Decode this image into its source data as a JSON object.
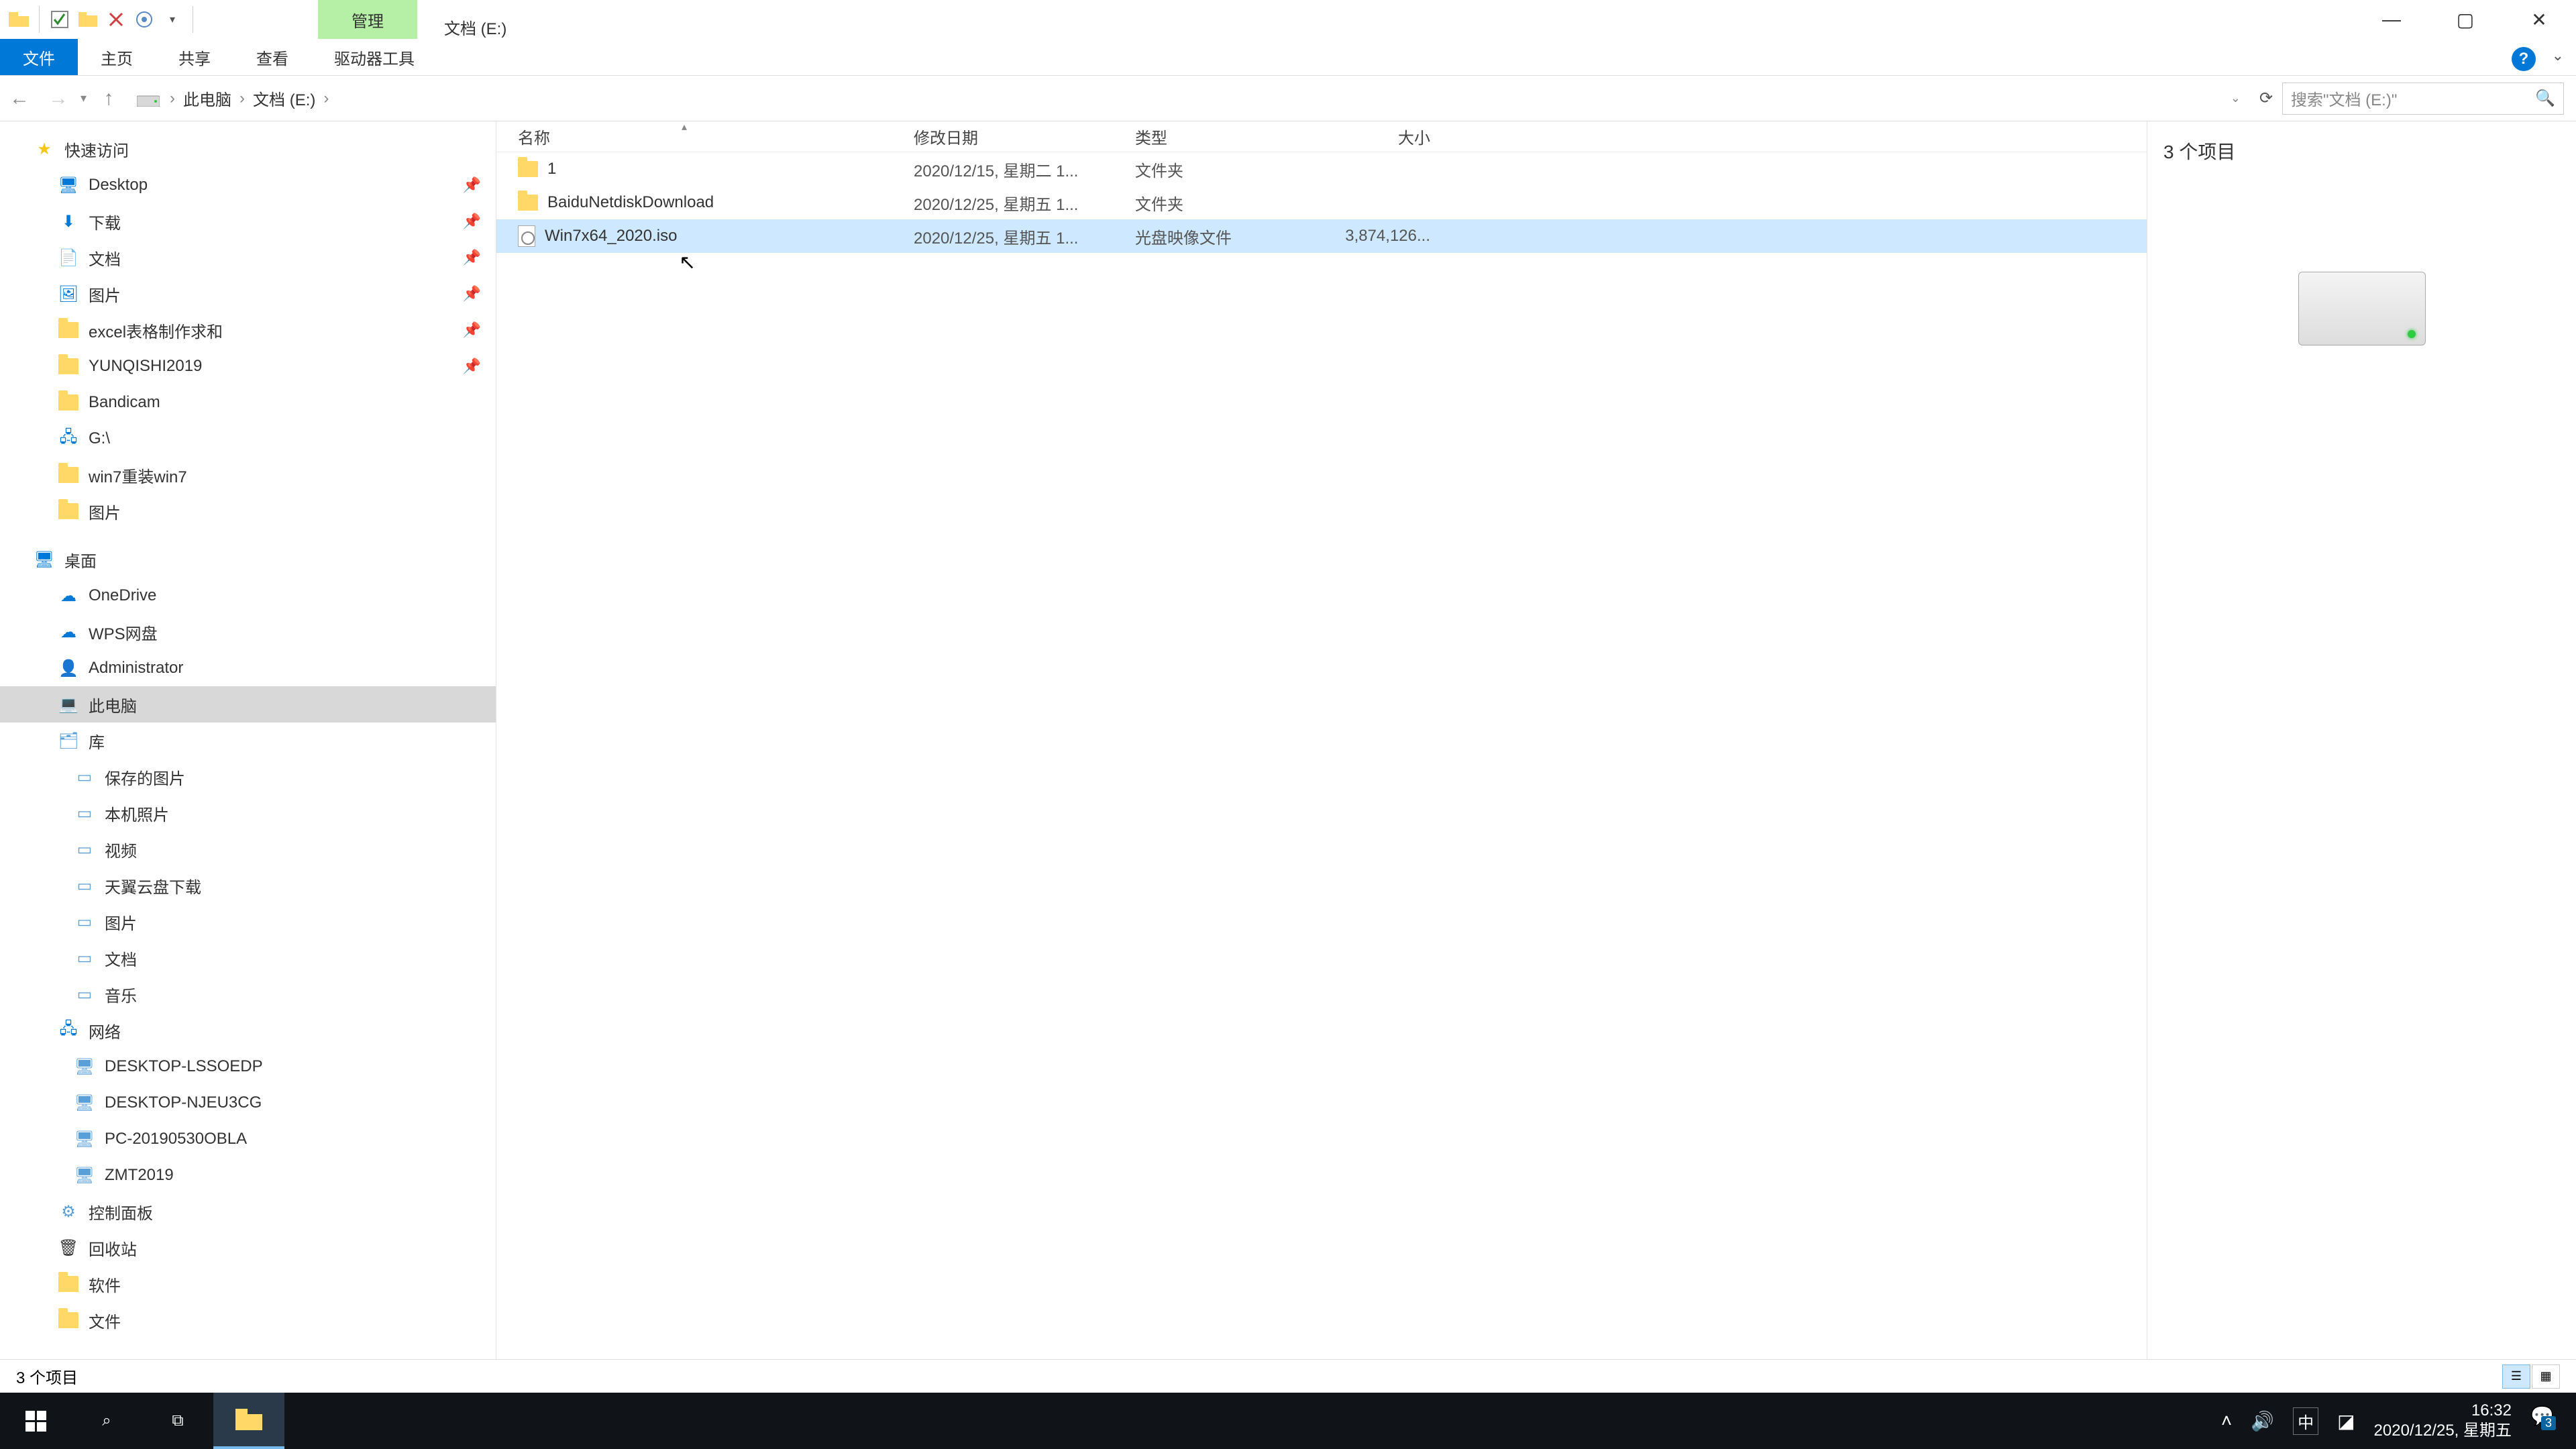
{
  "title": "文档 (E:)",
  "ribbon_context": "管理",
  "tabs": {
    "file": "文件",
    "home": "主页",
    "share": "共享",
    "view": "查看",
    "drive": "驱动器工具"
  },
  "breadcrumb": [
    "此电脑",
    "文档 (E:)"
  ],
  "search": {
    "placeholder": "搜索\"文档 (E:)\""
  },
  "columns": {
    "name": "名称",
    "date": "修改日期",
    "type": "类型",
    "size": "大小"
  },
  "rows": [
    {
      "name": "1",
      "date": "2020/12/15, 星期二 1...",
      "type": "文件夹",
      "size": "",
      "kind": "folder",
      "selected": false
    },
    {
      "name": "BaiduNetdiskDownload",
      "date": "2020/12/25, 星期五 1...",
      "type": "文件夹",
      "size": "",
      "kind": "folder",
      "selected": false
    },
    {
      "name": "Win7x64_2020.iso",
      "date": "2020/12/25, 星期五 1...",
      "type": "光盘映像文件",
      "size": "3,874,126...",
      "kind": "iso",
      "selected": true
    }
  ],
  "tree": {
    "quick": "快速访问",
    "quick_items": [
      {
        "l": "Desktop",
        "p": true,
        "ic": "desktop"
      },
      {
        "l": "下载",
        "p": true,
        "ic": "dl"
      },
      {
        "l": "文档",
        "p": true,
        "ic": "doc"
      },
      {
        "l": "图片",
        "p": true,
        "ic": "pic"
      },
      {
        "l": "excel表格制作求和",
        "p": true,
        "ic": "folder"
      },
      {
        "l": "YUNQISHI2019",
        "p": true,
        "ic": "folder"
      },
      {
        "l": "Bandicam",
        "p": false,
        "ic": "folder"
      },
      {
        "l": "G:\\",
        "p": false,
        "ic": "net"
      },
      {
        "l": "win7重装win7",
        "p": false,
        "ic": "folder"
      },
      {
        "l": "图片",
        "p": false,
        "ic": "folder"
      }
    ],
    "desktop": "桌面",
    "onedrive": "OneDrive",
    "wps": "WPS网盘",
    "admin": "Administrator",
    "thispc": "此电脑",
    "libs": "库",
    "lib_items": [
      "保存的图片",
      "本机照片",
      "视频",
      "天翼云盘下载",
      "图片",
      "文档",
      "音乐"
    ],
    "network": "网络",
    "net_items": [
      "DESKTOP-LSSOEDP",
      "DESKTOP-NJEU3CG",
      "PC-20190530OBLA",
      "ZMT2019"
    ],
    "cpanel": "控制面板",
    "recycle": "回收站",
    "soft": "软件",
    "wenjian": "文件"
  },
  "preview": {
    "count": "3 个项目"
  },
  "status": {
    "items": "3 个项目"
  },
  "taskbar": {
    "time": "16:32",
    "date": "2020/12/25, 星期五",
    "ime": "中",
    "notif_badge": "3"
  }
}
